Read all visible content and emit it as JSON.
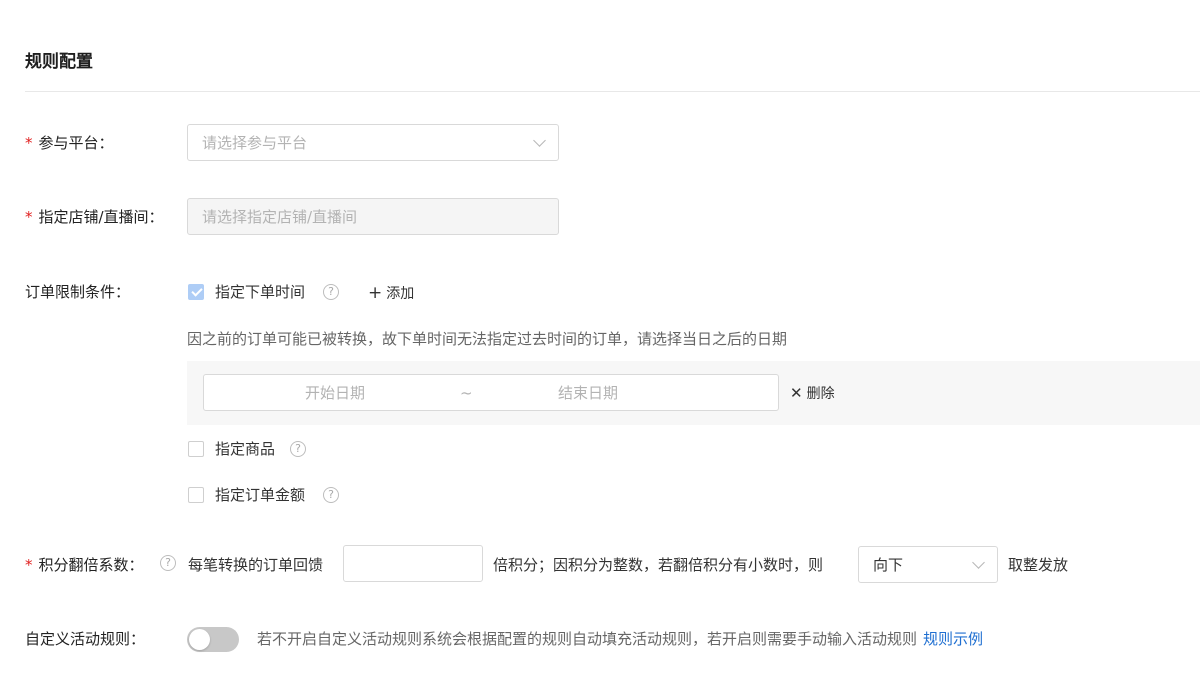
{
  "section_title": "规则配置",
  "platform": {
    "label": "参与平台：",
    "required_mark": "*",
    "placeholder": "请选择参与平台"
  },
  "store": {
    "label": "指定店铺/直播间：",
    "required_mark": "*",
    "placeholder": "请选择指定店铺/直播间"
  },
  "order_limit": {
    "label": "订单限制条件：",
    "options": [
      {
        "label": "指定下单时间",
        "checked": true
      },
      {
        "label": "指定商品",
        "checked": false
      },
      {
        "label": "指定订单金额",
        "checked": false
      }
    ],
    "add_label": "添加",
    "hint": "因之前的订单可能已被转换，故下单时间无法指定过去时间的订单，请选择当日之后的日期",
    "date_range": {
      "start_placeholder": "开始日期",
      "separator": "~",
      "end_placeholder": "结束日期"
    },
    "delete_label": "删除"
  },
  "multiplier": {
    "label": "积分翻倍系数：",
    "required_mark": "*",
    "prefix_text": "每笔转换的订单回馈",
    "value": "",
    "middle_text": "倍积分；因积分为整数，若翻倍积分有小数时，则",
    "rounding_selected": "向下",
    "suffix_text": "取整发放"
  },
  "custom_rules": {
    "label": "自定义活动规则：",
    "enabled": false,
    "description": "若不开启自定义活动规则系统会根据配置的规则自动填充活动规则，若开启则需要手动输入活动规则",
    "link_label": "规则示例"
  },
  "colors": {
    "accent": "#1f6fd1",
    "required": "#e02020",
    "checkbox_checked": "#aecdf6",
    "toggle_off": "#c8c8c8"
  },
  "icons": {
    "help": "question-circle-icon",
    "dropdown": "chevron-down-icon",
    "add": "plus-icon",
    "delete": "close-icon",
    "check": "check-icon"
  }
}
